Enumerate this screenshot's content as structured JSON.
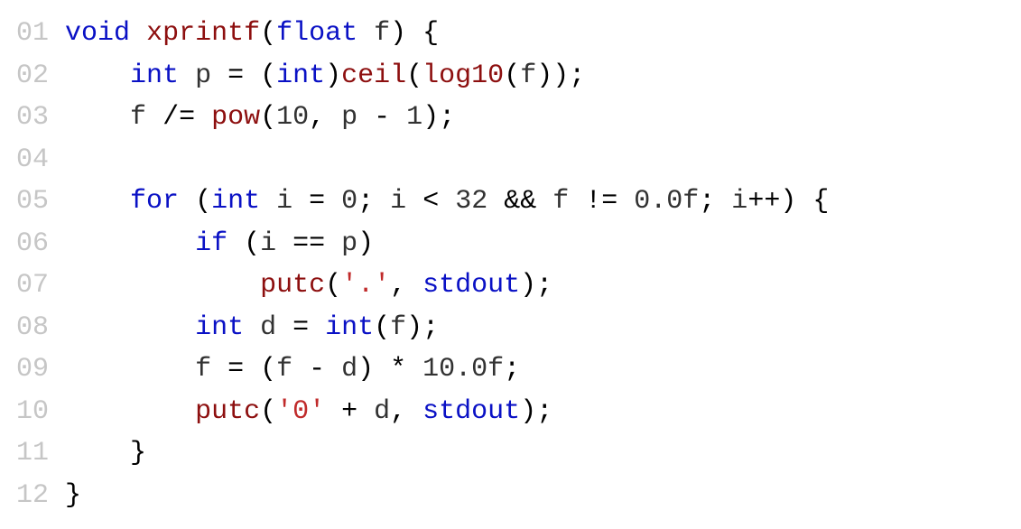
{
  "code": {
    "lines": [
      {
        "num": "01",
        "tokens": [
          {
            "cls": "kw",
            "text": "void"
          },
          {
            "cls": "op",
            "text": " "
          },
          {
            "cls": "func",
            "text": "xprintf"
          },
          {
            "cls": "op",
            "text": "("
          },
          {
            "cls": "kw",
            "text": "float"
          },
          {
            "cls": "op",
            "text": " "
          },
          {
            "cls": "ident",
            "text": "f"
          },
          {
            "cls": "op",
            "text": ") {"
          }
        ]
      },
      {
        "num": "02",
        "tokens": [
          {
            "cls": "op",
            "text": "    "
          },
          {
            "cls": "kw",
            "text": "int"
          },
          {
            "cls": "op",
            "text": " "
          },
          {
            "cls": "ident",
            "text": "p"
          },
          {
            "cls": "op",
            "text": " = ("
          },
          {
            "cls": "kw",
            "text": "int"
          },
          {
            "cls": "op",
            "text": ")"
          },
          {
            "cls": "func",
            "text": "ceil"
          },
          {
            "cls": "op",
            "text": "("
          },
          {
            "cls": "func",
            "text": "log10"
          },
          {
            "cls": "op",
            "text": "("
          },
          {
            "cls": "ident",
            "text": "f"
          },
          {
            "cls": "op",
            "text": "));"
          }
        ]
      },
      {
        "num": "03",
        "tokens": [
          {
            "cls": "op",
            "text": "    "
          },
          {
            "cls": "ident",
            "text": "f"
          },
          {
            "cls": "op",
            "text": " /= "
          },
          {
            "cls": "func",
            "text": "pow"
          },
          {
            "cls": "op",
            "text": "("
          },
          {
            "cls": "num",
            "text": "10"
          },
          {
            "cls": "op",
            "text": ", "
          },
          {
            "cls": "ident",
            "text": "p"
          },
          {
            "cls": "op",
            "text": " - "
          },
          {
            "cls": "num",
            "text": "1"
          },
          {
            "cls": "op",
            "text": ");"
          }
        ]
      },
      {
        "num": "04",
        "tokens": [
          {
            "cls": "op",
            "text": ""
          }
        ]
      },
      {
        "num": "05",
        "tokens": [
          {
            "cls": "op",
            "text": "    "
          },
          {
            "cls": "kw",
            "text": "for"
          },
          {
            "cls": "op",
            "text": " ("
          },
          {
            "cls": "kw",
            "text": "int"
          },
          {
            "cls": "op",
            "text": " "
          },
          {
            "cls": "ident",
            "text": "i"
          },
          {
            "cls": "op",
            "text": " = "
          },
          {
            "cls": "num",
            "text": "0"
          },
          {
            "cls": "op",
            "text": "; "
          },
          {
            "cls": "ident",
            "text": "i"
          },
          {
            "cls": "op",
            "text": " < "
          },
          {
            "cls": "num",
            "text": "32"
          },
          {
            "cls": "op",
            "text": " && "
          },
          {
            "cls": "ident",
            "text": "f"
          },
          {
            "cls": "op",
            "text": " != "
          },
          {
            "cls": "num",
            "text": "0.0f"
          },
          {
            "cls": "op",
            "text": "; "
          },
          {
            "cls": "ident",
            "text": "i"
          },
          {
            "cls": "op",
            "text": "++) {"
          }
        ]
      },
      {
        "num": "06",
        "tokens": [
          {
            "cls": "op",
            "text": "        "
          },
          {
            "cls": "kw",
            "text": "if"
          },
          {
            "cls": "op",
            "text": " ("
          },
          {
            "cls": "ident",
            "text": "i"
          },
          {
            "cls": "op",
            "text": " == "
          },
          {
            "cls": "ident",
            "text": "p"
          },
          {
            "cls": "op",
            "text": ")"
          }
        ]
      },
      {
        "num": "07",
        "tokens": [
          {
            "cls": "op",
            "text": "            "
          },
          {
            "cls": "func",
            "text": "putc"
          },
          {
            "cls": "op",
            "text": "("
          },
          {
            "cls": "char",
            "text": "'.'"
          },
          {
            "cls": "op",
            "text": ", "
          },
          {
            "cls": "std",
            "text": "stdout"
          },
          {
            "cls": "op",
            "text": ");"
          }
        ]
      },
      {
        "num": "08",
        "tokens": [
          {
            "cls": "op",
            "text": "        "
          },
          {
            "cls": "kw",
            "text": "int"
          },
          {
            "cls": "op",
            "text": " "
          },
          {
            "cls": "ident",
            "text": "d"
          },
          {
            "cls": "op",
            "text": " = "
          },
          {
            "cls": "kw",
            "text": "int"
          },
          {
            "cls": "op",
            "text": "("
          },
          {
            "cls": "ident",
            "text": "f"
          },
          {
            "cls": "op",
            "text": ");"
          }
        ]
      },
      {
        "num": "09",
        "tokens": [
          {
            "cls": "op",
            "text": "        "
          },
          {
            "cls": "ident",
            "text": "f"
          },
          {
            "cls": "op",
            "text": " = ("
          },
          {
            "cls": "ident",
            "text": "f"
          },
          {
            "cls": "op",
            "text": " - "
          },
          {
            "cls": "ident",
            "text": "d"
          },
          {
            "cls": "op",
            "text": ") * "
          },
          {
            "cls": "num",
            "text": "10.0f"
          },
          {
            "cls": "op",
            "text": ";"
          }
        ]
      },
      {
        "num": "10",
        "tokens": [
          {
            "cls": "op",
            "text": "        "
          },
          {
            "cls": "func",
            "text": "putc"
          },
          {
            "cls": "op",
            "text": "("
          },
          {
            "cls": "char",
            "text": "'0'"
          },
          {
            "cls": "op",
            "text": " + "
          },
          {
            "cls": "ident",
            "text": "d"
          },
          {
            "cls": "op",
            "text": ", "
          },
          {
            "cls": "std",
            "text": "stdout"
          },
          {
            "cls": "op",
            "text": ");"
          }
        ]
      },
      {
        "num": "11",
        "tokens": [
          {
            "cls": "op",
            "text": "    }"
          }
        ]
      },
      {
        "num": "12",
        "tokens": [
          {
            "cls": "op",
            "text": "}"
          }
        ]
      }
    ]
  }
}
